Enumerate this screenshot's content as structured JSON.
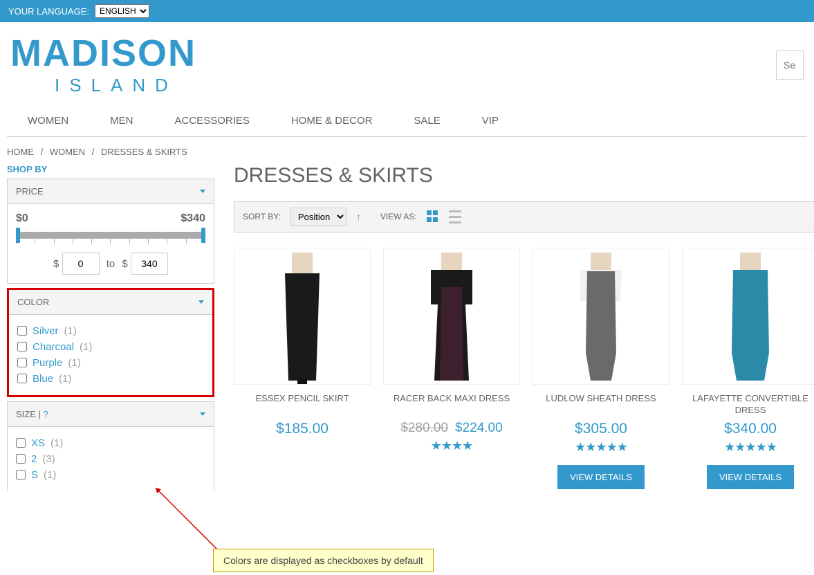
{
  "topbar": {
    "language_label": "YOUR LANGUAGE:",
    "language_value": "ENGLISH"
  },
  "logo": {
    "top": "MADISON",
    "bottom": "ISLAND"
  },
  "search": {
    "placeholder": "Sea"
  },
  "nav": [
    "WOMEN",
    "MEN",
    "ACCESSORIES",
    "HOME & DECOR",
    "SALE",
    "VIP"
  ],
  "breadcrumbs": [
    "HOME",
    "WOMEN",
    "DRESSES & SKIRTS"
  ],
  "sidebar": {
    "shop_by": "SHOP BY",
    "price_title": "PRICE",
    "price_min": "$0",
    "price_max": "$340",
    "price_from": "0",
    "price_to_label": "to",
    "price_to": "340",
    "color_title": "COLOR",
    "colors": [
      {
        "label": "Silver",
        "count": "(1)"
      },
      {
        "label": "Charcoal",
        "count": "(1)"
      },
      {
        "label": "Purple",
        "count": "(1)"
      },
      {
        "label": "Blue",
        "count": "(1)"
      }
    ],
    "size_title": "SIZE | ",
    "size_help": "?",
    "sizes": [
      {
        "label": "XS",
        "count": "(1)"
      },
      {
        "label": "2",
        "count": "(3)"
      },
      {
        "label": "S",
        "count": "(1)"
      }
    ]
  },
  "page_title": "DRESSES & SKIRTS",
  "toolbar": {
    "sort_label": "SORT BY:",
    "sort_value": "Position",
    "view_label": "VIEW AS:"
  },
  "products": [
    {
      "name": "ESSEX PENCIL SKIRT",
      "price": "$185.00",
      "old": "",
      "stars": "",
      "btn": ""
    },
    {
      "name": "RACER BACK MAXI DRESS",
      "price": "$224.00",
      "old": "$280.00",
      "stars": "★★★★",
      "btn": ""
    },
    {
      "name": "LUDLOW SHEATH DRESS",
      "price": "$305.00",
      "old": "",
      "stars": "★★★★★",
      "btn": "VIEW DETAILS"
    },
    {
      "name": "LAFAYETTE CONVERTIBLE DRESS",
      "price": "$340.00",
      "old": "",
      "stars": "★★★★★",
      "btn": "VIEW DETAILS"
    }
  ],
  "annotation": "Colors are displayed as checkboxes by default"
}
